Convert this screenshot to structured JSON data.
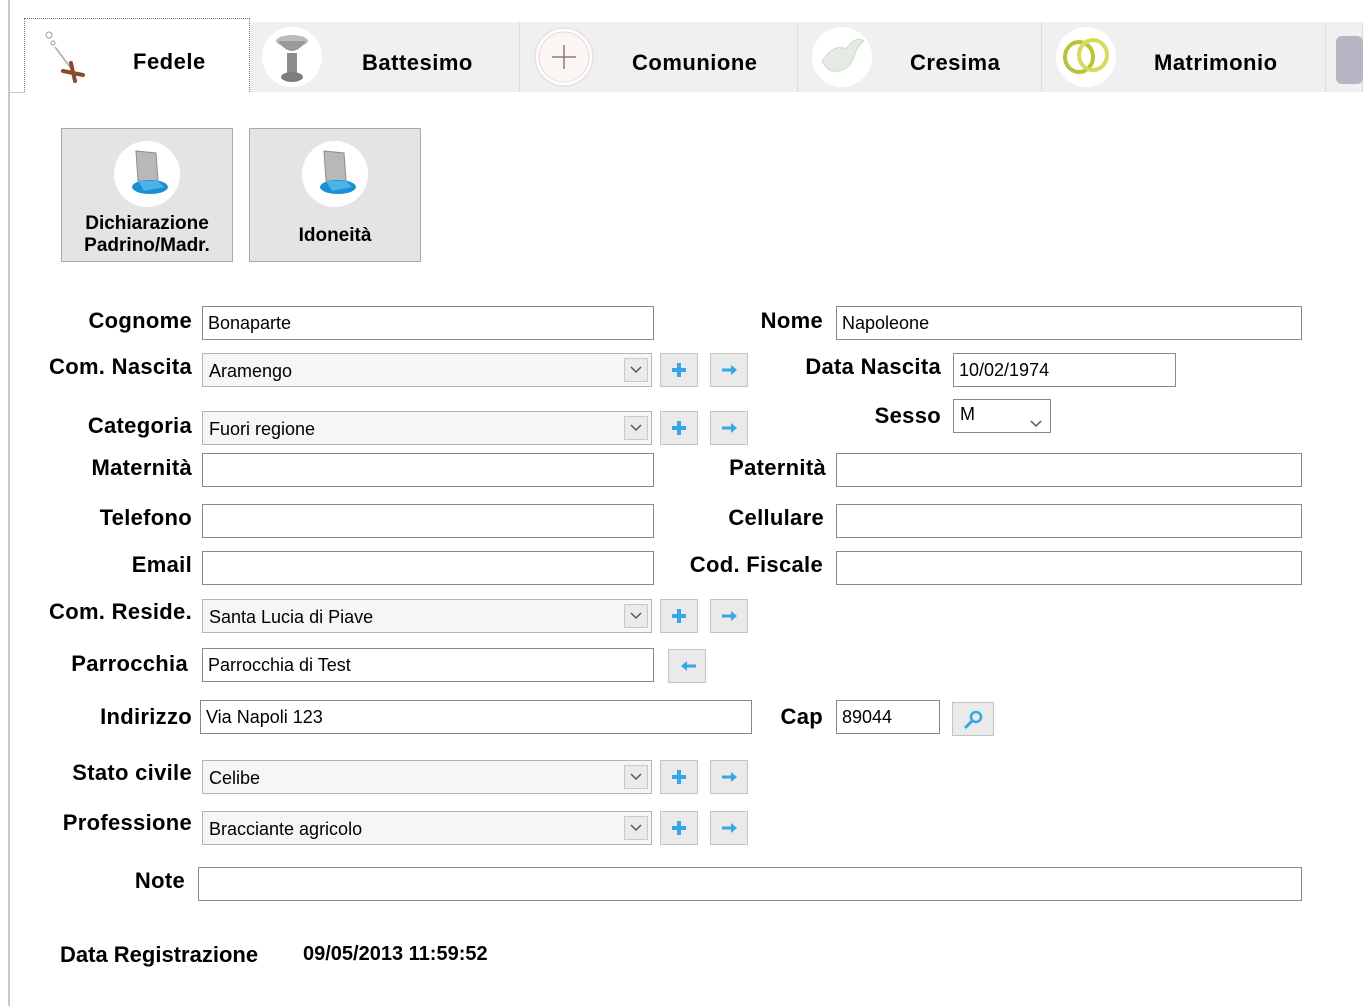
{
  "tabs": [
    {
      "label": "Fedele",
      "icon": "rosary-icon"
    },
    {
      "label": "Battesimo",
      "icon": "baptismal-font-icon"
    },
    {
      "label": "Comunione",
      "icon": "host-cross-icon"
    },
    {
      "label": "Cresima",
      "icon": "dove-icon"
    },
    {
      "label": "Matrimonio",
      "icon": "wedding-rings-icon"
    }
  ],
  "actions": {
    "dichiarazione_line1": "Dichiarazione",
    "dichiarazione_line2": "Padrino/Madr.",
    "idoneita": "Idoneità"
  },
  "form": {
    "cognome": {
      "label": "Cognome",
      "value": "Bonaparte"
    },
    "nome": {
      "label": "Nome",
      "value": "Napoleone"
    },
    "com_nascita": {
      "label": "Com. Nascita",
      "value": "Aramengo"
    },
    "data_nascita": {
      "label": "Data Nascita",
      "value": "10/02/1974"
    },
    "categoria": {
      "label": "Categoria",
      "value": "Fuori regione"
    },
    "sesso": {
      "label": "Sesso",
      "value": "M"
    },
    "maternita": {
      "label": "Maternità",
      "value": ""
    },
    "paternita": {
      "label": "Paternità",
      "value": ""
    },
    "telefono": {
      "label": "Telefono",
      "value": ""
    },
    "cellulare": {
      "label": "Cellulare",
      "value": ""
    },
    "email": {
      "label": "Email",
      "value": ""
    },
    "cod_fiscale": {
      "label": "Cod. Fiscale",
      "value": ""
    },
    "com_reside": {
      "label": "Com. Reside.",
      "value": "Santa Lucia di Piave"
    },
    "parrocchia": {
      "label": "Parrocchia",
      "value": "Parrocchia di Test"
    },
    "indirizzo": {
      "label": "Indirizzo",
      "value": "Via Napoli 123"
    },
    "cap": {
      "label": "Cap",
      "value": "89044"
    },
    "stato_civile": {
      "label": "Stato civile",
      "value": "Celibe"
    },
    "professione": {
      "label": "Professione",
      "value": "Bracciante agricolo"
    },
    "note": {
      "label": "Note",
      "value": ""
    }
  },
  "registration": {
    "label": "Data Registrazione",
    "value": "09/05/2013 11:59:52"
  },
  "colors": {
    "accent_icon": "#35a7e6",
    "tab_bg": "#f0f0f0",
    "button_bg": "#e4e4e4"
  }
}
